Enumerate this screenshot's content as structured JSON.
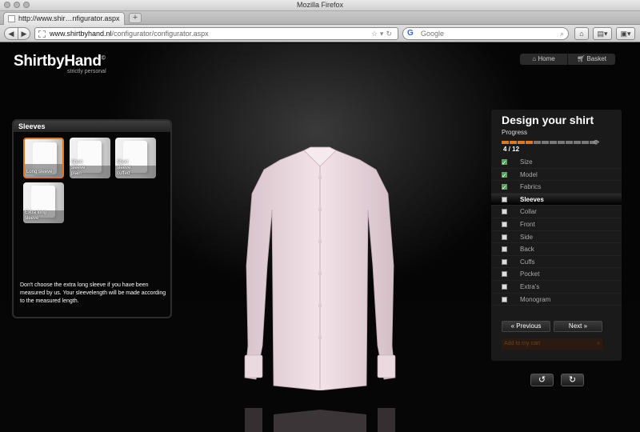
{
  "browser": {
    "window_title": "Mozilla Firefox",
    "tab_label": "http://www.shir…nfigurator.aspx",
    "new_tab": "+",
    "url_host": "www.shirtbyhand.nl",
    "url_path": "/configurator/configurator.aspx",
    "search_placeholder": "Google"
  },
  "site": {
    "logo": "ShirtbyHand",
    "logo_mark": "©",
    "tagline": "strictly personal",
    "nav_home": "Home",
    "nav_basket": "Basket"
  },
  "sleeves_panel": {
    "title": "Sleeves",
    "options": [
      {
        "label": "Long sleeve",
        "selected": true
      },
      {
        "label": "Short sleeve plain",
        "selected": false
      },
      {
        "label": "Short sleeve cuffed",
        "selected": false
      },
      {
        "label": "Extra long sleeve",
        "selected": false
      }
    ],
    "description": "Don't choose the extra long sleeve if you have been measured by us. Your sleevelength will be made according to the measured length."
  },
  "design_panel": {
    "title": "Design your shirt",
    "progress_label": "Progress",
    "progress_text": "4 / 12",
    "progress_done": 4,
    "progress_total": 12,
    "steps": [
      {
        "label": "Size",
        "state": "done"
      },
      {
        "label": "Model",
        "state": "done"
      },
      {
        "label": "Fabrics",
        "state": "done"
      },
      {
        "label": "Sleeves",
        "state": "active"
      },
      {
        "label": "Collar",
        "state": "todo"
      },
      {
        "label": "Front",
        "state": "todo"
      },
      {
        "label": "Side",
        "state": "todo"
      },
      {
        "label": "Back",
        "state": "todo"
      },
      {
        "label": "Cuffs",
        "state": "todo"
      },
      {
        "label": "Pocket",
        "state": "todo"
      },
      {
        "label": "Extra's",
        "state": "todo"
      },
      {
        "label": "Monogram",
        "state": "todo"
      }
    ],
    "previous": "Previous",
    "next": "Next",
    "add_to_cart": "Add to my cart"
  },
  "colors": {
    "accent": "#e2761a",
    "shirt": "#efdde4"
  }
}
